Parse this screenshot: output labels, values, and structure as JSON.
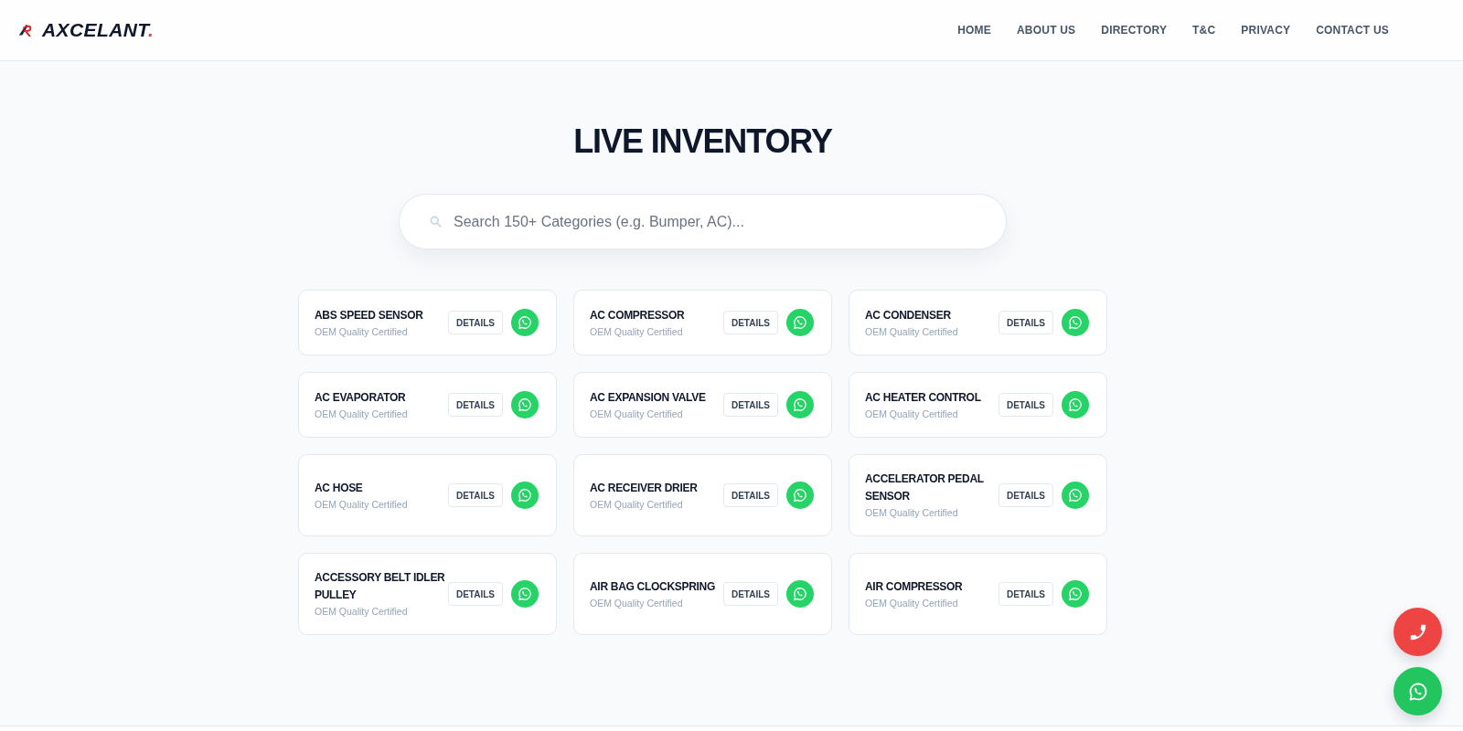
{
  "header": {
    "brand": {
      "name": "AXCELANT",
      "accent": "."
    },
    "nav": [
      {
        "label": "HOME"
      },
      {
        "label": "ABOUT US"
      },
      {
        "label": "DIRECTORY"
      },
      {
        "label": "T&C"
      },
      {
        "label": "PRIVACY"
      },
      {
        "label": "CONTACT US"
      }
    ]
  },
  "page": {
    "title": "LIVE INVENTORY",
    "search": {
      "placeholder": "Search 150+ Categories (e.g. Bumper, AC)..."
    }
  },
  "products": [
    {
      "name": "ABS SPEED SENSOR",
      "subtitle": "OEM Quality Certified",
      "button": "DETAILS"
    },
    {
      "name": "AC COMPRESSOR",
      "subtitle": "OEM Quality Certified",
      "button": "DETAILS"
    },
    {
      "name": "AC CONDENSER",
      "subtitle": "OEM Quality Certified",
      "button": "DETAILS"
    },
    {
      "name": "AC EVAPORATOR",
      "subtitle": "OEM Quality Certified",
      "button": "DETAILS"
    },
    {
      "name": "AC EXPANSION VALVE",
      "subtitle": "OEM Quality Certified",
      "button": "DETAILS"
    },
    {
      "name": "AC HEATER CONTROL",
      "subtitle": "OEM Quality Certified",
      "button": "DETAILS"
    },
    {
      "name": "AC HOSE",
      "subtitle": "OEM Quality Certified",
      "button": "DETAILS"
    },
    {
      "name": "AC RECEIVER DRIER",
      "subtitle": "OEM Quality Certified",
      "button": "DETAILS"
    },
    {
      "name": "ACCELERATOR PEDAL SENSOR",
      "subtitle": "OEM Quality Certified",
      "button": "DETAILS"
    },
    {
      "name": "ACCESSORY BELT IDLER PULLEY",
      "subtitle": "OEM Quality Certified",
      "button": "DETAILS"
    },
    {
      "name": "AIR BAG CLOCKSPRING",
      "subtitle": "OEM Quality Certified",
      "button": "DETAILS"
    },
    {
      "name": "AIR COMPRESSOR",
      "subtitle": "OEM Quality Certified",
      "button": "DETAILS"
    }
  ],
  "floating_actions": [
    {
      "kind": "call"
    },
    {
      "kind": "chat"
    }
  ]
}
